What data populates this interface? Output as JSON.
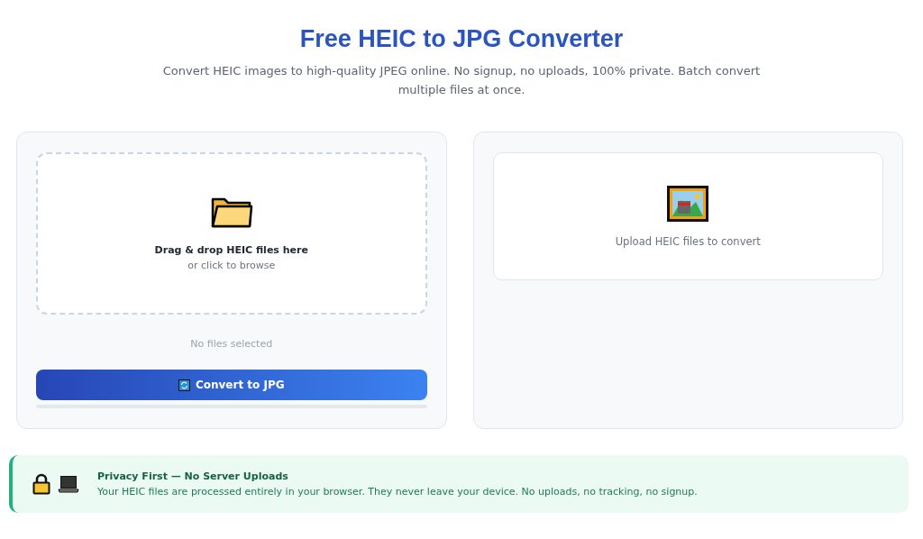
{
  "header": {
    "title": "Free HEIC to JPG Converter",
    "subtitle": "Convert HEIC images to high-quality JPEG online. No signup, no uploads, 100% private. Batch convert multiple files at once."
  },
  "dropzone": {
    "title": "Drag & drop HEIC files here",
    "hint": "or click to browse"
  },
  "file_status": "No files selected",
  "convert_button": {
    "label": "Convert to JPG",
    "disabled": false
  },
  "progress": {
    "level": 0
  },
  "preview": {
    "message": "Upload HEIC files to convert"
  },
  "privacy": {
    "title": "Privacy First — No Server Uploads",
    "text": "Your HEIC files are processed entirely in your browser. They never leave your device. No uploads, no tracking, no signup."
  }
}
